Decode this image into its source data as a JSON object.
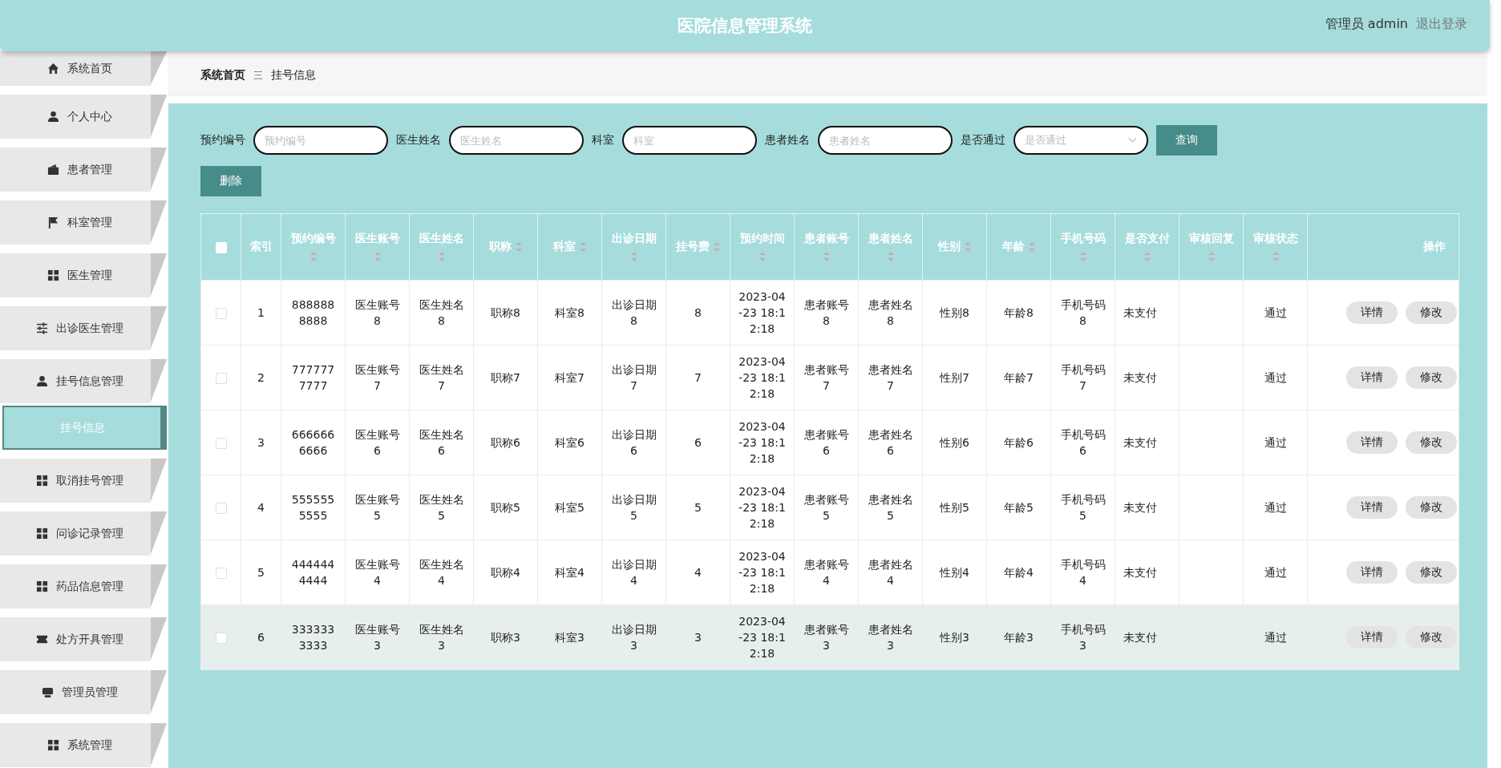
{
  "header": {
    "title": "医院信息管理系统",
    "user": "管理员 admin",
    "logout": "退出登录"
  },
  "sidebar": {
    "items": [
      {
        "label": "系统首页",
        "selected": false
      },
      {
        "label": "个人中心",
        "selected": false
      },
      {
        "label": "患者管理",
        "selected": false
      },
      {
        "label": "科室管理",
        "selected": false
      },
      {
        "label": "医生管理",
        "selected": false
      },
      {
        "label": "出诊医生管理",
        "selected": false
      },
      {
        "label": "挂号信息管理",
        "selected": false,
        "children": [
          {
            "label": "挂号信息",
            "selected": true
          }
        ]
      },
      {
        "label": "取消挂号管理",
        "selected": false
      },
      {
        "label": "问诊记录管理",
        "selected": false
      },
      {
        "label": "药品信息管理",
        "selected": false
      },
      {
        "label": "处方开具管理",
        "selected": false
      },
      {
        "label": "管理员管理",
        "selected": false
      },
      {
        "label": "系统管理",
        "selected": false
      }
    ]
  },
  "breadcrumb": {
    "items": [
      "系统首页",
      "挂号信息"
    ],
    "separator": "三"
  },
  "filters": [
    {
      "label": "预约编号",
      "placeholder": "预约编号",
      "kind": "text"
    },
    {
      "label": "医生姓名",
      "placeholder": "医生姓名",
      "kind": "text"
    },
    {
      "label": "科室",
      "placeholder": "科室",
      "kind": "text"
    },
    {
      "label": "患者姓名",
      "placeholder": "患者姓名",
      "kind": "text"
    },
    {
      "label": "是否通过",
      "placeholder": "是否通过",
      "kind": "select"
    }
  ],
  "search_button": "查询",
  "delete_button": "删除",
  "table": {
    "select_all_checked": false,
    "columns": [
      {
        "label": "索引",
        "sortable": false
      },
      {
        "label": "预约编号",
        "sortable": true
      },
      {
        "label": "医生账号",
        "sortable": true
      },
      {
        "label": "医生姓名",
        "sortable": true
      },
      {
        "label": "职称",
        "sortable": true
      },
      {
        "label": "科室",
        "sortable": true
      },
      {
        "label": "出诊日期",
        "sortable": true
      },
      {
        "label": "挂号费",
        "sortable": true
      },
      {
        "label": "预约时间",
        "sortable": true
      },
      {
        "label": "患者账号",
        "sortable": true
      },
      {
        "label": "患者姓名",
        "sortable": true
      },
      {
        "label": "性别",
        "sortable": true
      },
      {
        "label": "年龄",
        "sortable": true
      },
      {
        "label": "手机号码",
        "sortable": true
      },
      {
        "label": "是否支付",
        "sortable": true
      },
      {
        "label": "审核回复",
        "sortable": true
      },
      {
        "label": "审核状态",
        "sortable": true
      },
      {
        "label": "操作",
        "sortable": false
      }
    ],
    "rows": [
      {
        "checked": false,
        "highlighted": false,
        "cells": [
          "1",
          "8888888888",
          "医生账号8",
          "医生姓名8",
          "职称8",
          "科室8",
          "出诊日期8",
          "8",
          "2023-04-23 18:12:18",
          "患者账号8",
          "患者姓名8",
          "性别8",
          "年龄8",
          "手机号码8",
          "未支付",
          "",
          "通过"
        ],
        "actions": [
          "详情",
          "修改"
        ]
      },
      {
        "checked": false,
        "highlighted": false,
        "cells": [
          "2",
          "7777777777",
          "医生账号7",
          "医生姓名7",
          "职称7",
          "科室7",
          "出诊日期7",
          "7",
          "2023-04-23 18:12:18",
          "患者账号7",
          "患者姓名7",
          "性别7",
          "年龄7",
          "手机号码7",
          "未支付",
          "",
          "通过"
        ],
        "actions": [
          "详情",
          "修改"
        ]
      },
      {
        "checked": false,
        "highlighted": false,
        "cells": [
          "3",
          "6666666666",
          "医生账号6",
          "医生姓名6",
          "职称6",
          "科室6",
          "出诊日期6",
          "6",
          "2023-04-23 18:12:18",
          "患者账号6",
          "患者姓名6",
          "性别6",
          "年龄6",
          "手机号码6",
          "未支付",
          "",
          "通过"
        ],
        "actions": [
          "详情",
          "修改"
        ]
      },
      {
        "checked": false,
        "highlighted": false,
        "cells": [
          "4",
          "5555555555",
          "医生账号5",
          "医生姓名5",
          "职称5",
          "科室5",
          "出诊日期5",
          "5",
          "2023-04-23 18:12:18",
          "患者账号5",
          "患者姓名5",
          "性别5",
          "年龄5",
          "手机号码5",
          "未支付",
          "",
          "通过"
        ],
        "actions": [
          "详情",
          "修改"
        ]
      },
      {
        "checked": false,
        "highlighted": false,
        "cells": [
          "5",
          "4444444444",
          "医生账号4",
          "医生姓名4",
          "职称4",
          "科室4",
          "出诊日期4",
          "4",
          "2023-04-23 18:12:18",
          "患者账号4",
          "患者姓名4",
          "性别4",
          "年龄4",
          "手机号码4",
          "未支付",
          "",
          "通过"
        ],
        "actions": [
          "详情",
          "修改"
        ]
      },
      {
        "checked": false,
        "highlighted": true,
        "cells": [
          "6",
          "3333333333",
          "医生账号3",
          "医生姓名3",
          "职称3",
          "科室3",
          "出诊日期3",
          "3",
          "2023-04-23 18:12:18",
          "患者账号3",
          "患者姓名3",
          "性别3",
          "年龄3",
          "手机号码3",
          "未支付",
          "",
          "通过"
        ],
        "actions": [
          "详情",
          "修改"
        ]
      }
    ]
  }
}
